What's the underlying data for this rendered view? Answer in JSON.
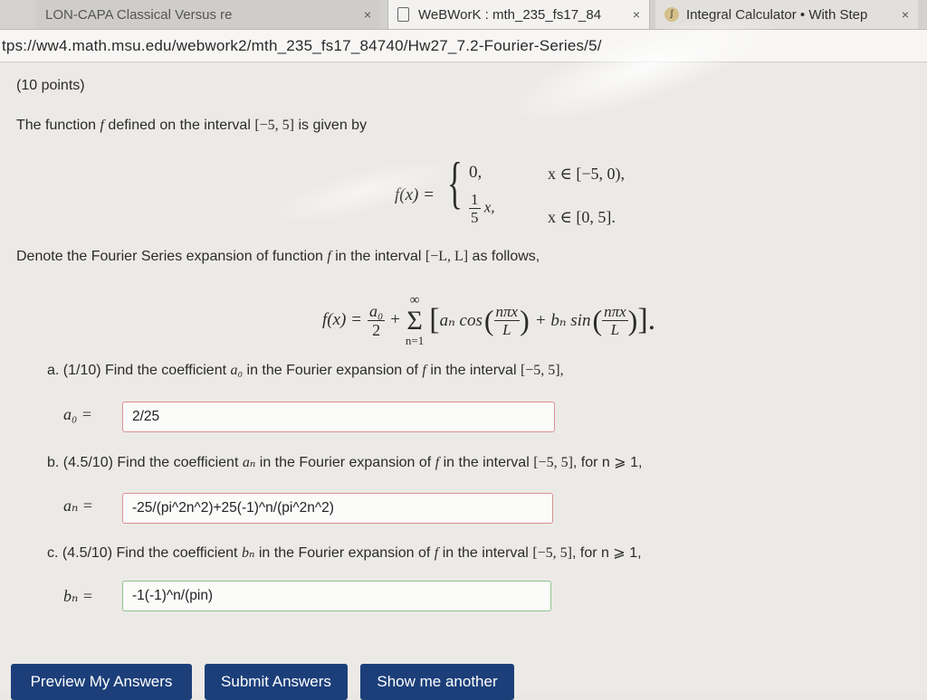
{
  "browser": {
    "tabs": [
      {
        "label": "LON-CAPA Classical Versus re",
        "close": "×"
      },
      {
        "label": "WeBWorK : mth_235_fs17_84",
        "close": "×"
      },
      {
        "label": "Integral Calculator • With Step",
        "close": "×"
      }
    ],
    "url": "tps://ww4.math.msu.edu/webwork2/mth_235_fs17_84740/Hw27_7.2-Fourier-Series/5/"
  },
  "problem": {
    "points": "(10 points)",
    "intro_prefix": "The function",
    "intro_f": "f",
    "intro_mid": "defined on the interval",
    "interval": "[−5, 5]",
    "intro_suffix": "is given by",
    "piecewise": {
      "lhs": "f(x) =",
      "case1_value": "0,",
      "case1_domain": "x ∈ [−5, 0),",
      "case2_num": "1",
      "case2_den": "5",
      "case2_var": "x,",
      "case2_domain": "x ∈ [0, 5]."
    },
    "denote_prefix": "Denote the Fourier Series expansion of function",
    "denote_f": "f",
    "denote_mid": "in the interval",
    "denote_interval": "[−L, L]",
    "denote_suffix": "as follows,",
    "series": {
      "lhs": "f(x) =",
      "a0_num": "a₀",
      "a0_den": "2",
      "plus": "+",
      "sum_top": "∞",
      "sum_symbol": "Σ",
      "sum_bottom": "n=1",
      "body_a": "aₙ cos",
      "frac_num": "nπx",
      "frac_den": "L",
      "body_b": "+ bₙ sin",
      "frac2_num": "nπx",
      "frac2_den": "L"
    },
    "parts": [
      {
        "label": "a. (1/10) Find the coefficient",
        "symbol": "a₀",
        "rest": "in the Fourier expansion of",
        "f": "f",
        "rest2": "in the interval",
        "interval": "[−5, 5],",
        "suffix": "",
        "answer_label": "a₀ =",
        "answer": "2/25"
      },
      {
        "label": "b. (4.5/10) Find the coefficient",
        "symbol": "aₙ",
        "rest": "in the Fourier expansion of",
        "f": "f",
        "rest2": "in the interval",
        "interval": "[−5, 5]",
        "suffix": ", for n ⩾ 1,",
        "answer_label": "aₙ =",
        "answer": "-25/(pi^2n^2)+25(-1)^n/(pi^2n^2)"
      },
      {
        "label": "c. (4.5/10) Find the coefficient",
        "symbol": "bₙ",
        "rest": "in the Fourier expansion of",
        "f": "f",
        "rest2": "in the interval",
        "interval": "[−5, 5]",
        "suffix": ", for n ⩾ 1,",
        "answer_label": "bₙ =",
        "answer": "-1(-1)^n/(pin)"
      }
    ]
  },
  "buttons": {
    "preview": "Preview My Answers",
    "submit": "Submit Answers",
    "another": "Show me another"
  },
  "colors": {
    "button_bg": "#1c3f7a",
    "incorrect_border": "#d98f8f",
    "correct_border": "#8dc08d"
  }
}
